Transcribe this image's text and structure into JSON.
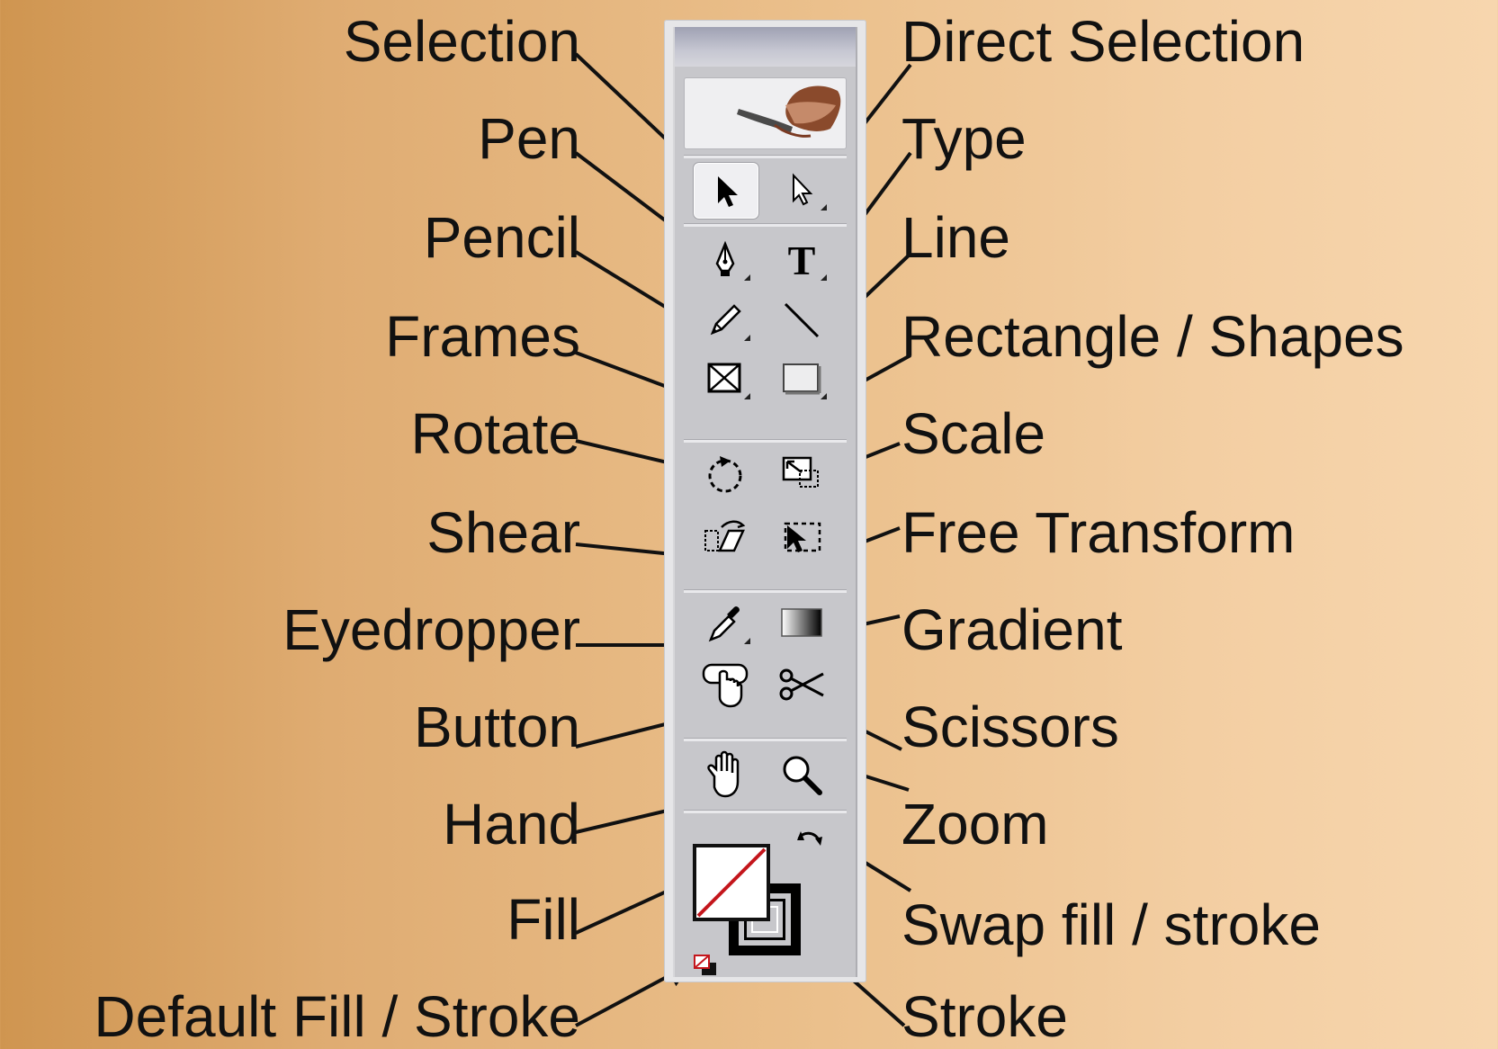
{
  "colors": {
    "background_left": "#cf9550",
    "background_right": "#f7d6ae",
    "toolbox": "#c7c7cb",
    "fill_slash": "#c4161c"
  },
  "labels_left": {
    "selection": "Selection",
    "pen": "Pen",
    "pencil": "Pencil",
    "frames": "Frames",
    "rotate": "Rotate",
    "shear": "Shear",
    "eyedropper": "Eyedropper",
    "button": "Button",
    "hand": "Hand",
    "fill": "Fill",
    "default_fill_stroke": "Default Fill / Stroke"
  },
  "labels_right": {
    "direct_selection": "Direct Selection",
    "type": "Type",
    "line": "Line",
    "rectangle_shapes": "Rectangle / Shapes",
    "scale": "Scale",
    "free_transform": "Free Transform",
    "gradient": "Gradient",
    "scissors": "Scissors",
    "zoom": "Zoom",
    "swap_fill_stroke": "Swap fill / stroke",
    "stroke": "Stroke"
  },
  "tools": {
    "type_glyph": "T",
    "active_tool": "selection"
  }
}
